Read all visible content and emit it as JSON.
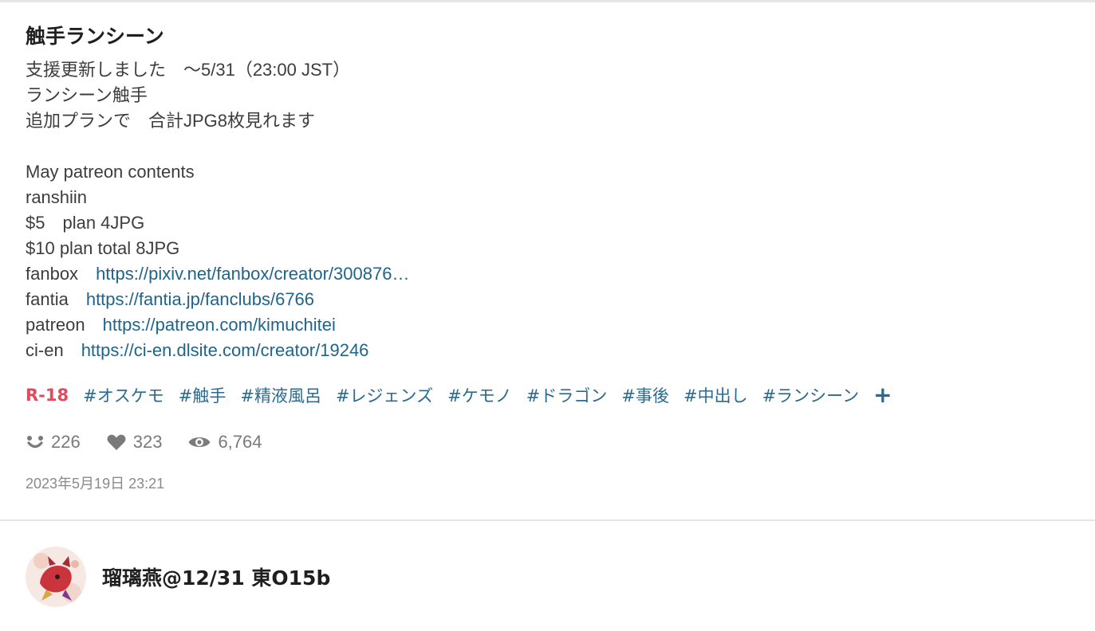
{
  "post": {
    "title": "触手ランシーン",
    "caption_lines": [
      {
        "text": "支援更新しました　～5/31（23:00 JST）"
      },
      {
        "text": "ランシーン触手"
      },
      {
        "text": "追加プランで　合計JPG8枚見れます"
      },
      {
        "text": ""
      },
      {
        "text": "May patreon contents"
      },
      {
        "text": "ranshiin"
      },
      {
        "text": "$5　plan 4JPG"
      },
      {
        "text": "$10 plan total 8JPG"
      }
    ],
    "links": [
      {
        "label": "fanbox　",
        "url": "https://pixiv.net/fanbox/creator/300876…"
      },
      {
        "label": "fantia　",
        "url": "https://fantia.jp/fanclubs/6766"
      },
      {
        "label": "patreon　",
        "url": "https://patreon.com/kimuchitei"
      },
      {
        "label": "ci-en　",
        "url": "https://ci-en.dlsite.com/creator/19246"
      }
    ],
    "rating": "R-18",
    "tags": [
      "#オスケモ",
      "#触手",
      "#精液風呂",
      "#レジェンズ",
      "#ケモノ",
      "#ドラゴン",
      "#事後",
      "#中出し",
      "#ランシーン"
    ],
    "tag_add": "+",
    "stats": {
      "reactions": "226",
      "likes": "323",
      "views": "6,764"
    },
    "date": "2023年5月19日 23:21"
  },
  "author": {
    "name": "瑠璃燕@12/31 東O15b"
  },
  "icons": {
    "reactions": "smile-icon",
    "likes": "heart-icon",
    "views": "eye-icon",
    "add_tag": "plus-icon"
  },
  "colors": {
    "link": "#21648a",
    "rating": "#e24a5e",
    "tag": "#2c6a8f",
    "muted": "#7a7a7a"
  }
}
